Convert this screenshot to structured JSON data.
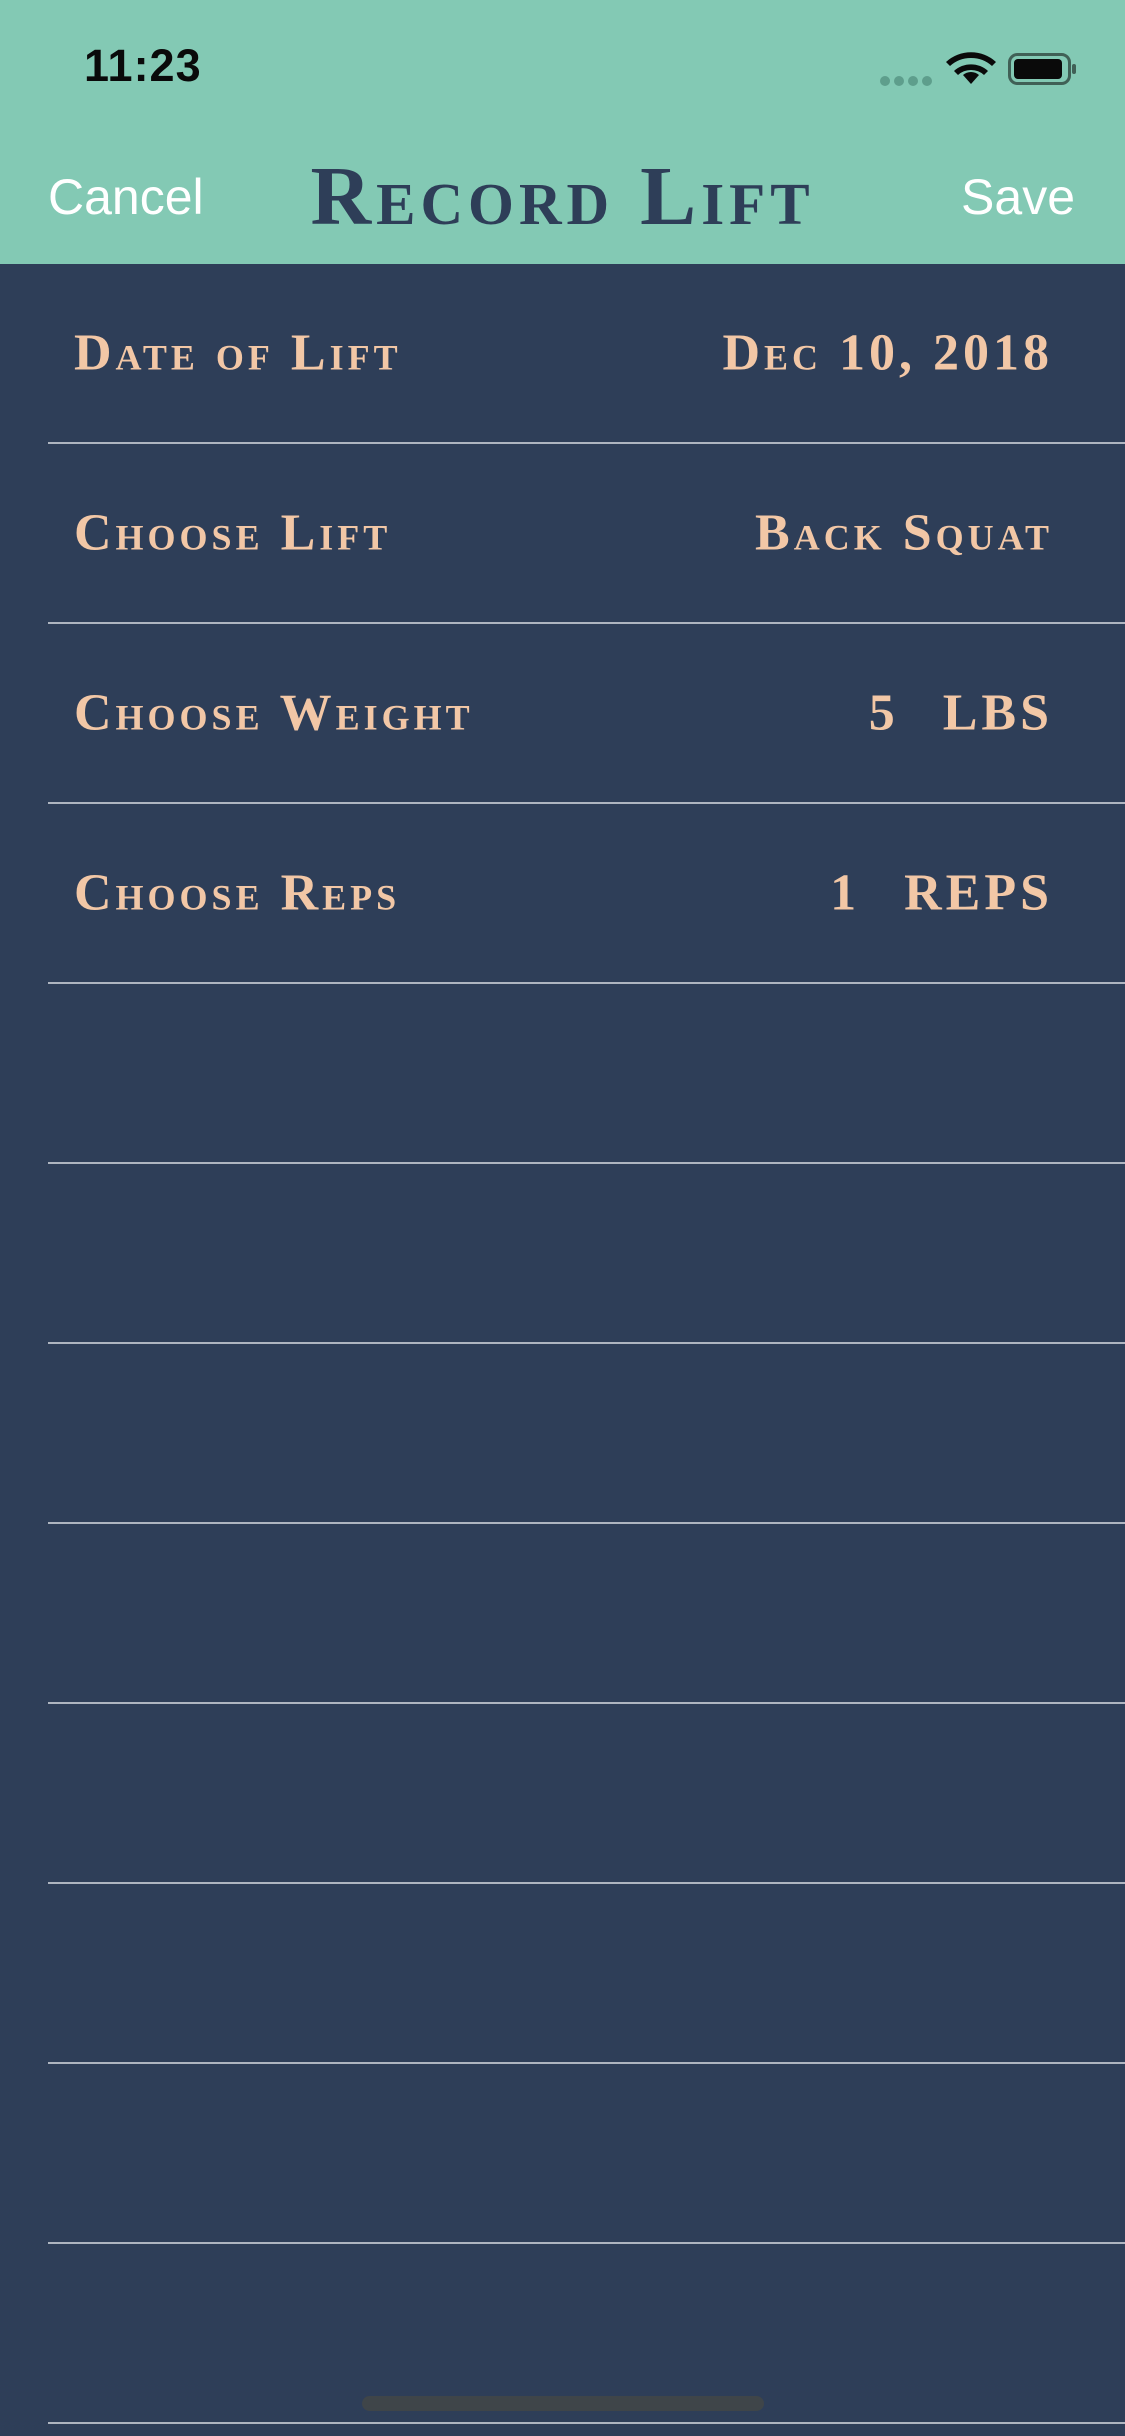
{
  "status_bar": {
    "time": "11:23"
  },
  "nav": {
    "cancel_label": "Cancel",
    "title": "Record Lift",
    "save_label": "Save"
  },
  "form": {
    "rows": [
      {
        "label": "Date of Lift",
        "value": "Dec 10, 2018"
      },
      {
        "label": "Choose Lift",
        "value": "Back Squat"
      },
      {
        "label": "Choose Weight",
        "number": "5",
        "unit": "LBS"
      },
      {
        "label": "Choose Reps",
        "number": "1",
        "unit": "REPS"
      }
    ]
  },
  "colors": {
    "header_background": "#83c9b4",
    "page_background": "#2e3e58",
    "label_text": "#f2c7a6",
    "title_text": "#2e3e58",
    "divider": "#aeb5c0"
  },
  "icons": {
    "signal": "cellular-signal-icon",
    "wifi": "wifi-icon",
    "battery": "battery-icon"
  }
}
